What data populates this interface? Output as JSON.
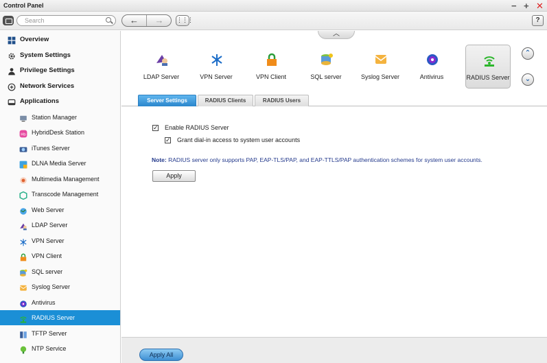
{
  "window": {
    "title": "Control Panel",
    "minimize": "−",
    "maximize": "+",
    "close": "✕"
  },
  "toolbar": {
    "search_placeholder": "Search",
    "back": "←",
    "forward": "→",
    "grid": "⋮⋮⋮",
    "help": "?"
  },
  "sidebar": {
    "items": [
      {
        "label": "Overview",
        "type": "cat",
        "icon": "overview-icon"
      },
      {
        "label": "System Settings",
        "type": "cat",
        "icon": "gear-icon"
      },
      {
        "label": "Privilege Settings",
        "type": "cat",
        "icon": "user-icon"
      },
      {
        "label": "Network Services",
        "type": "cat",
        "icon": "network-icon"
      },
      {
        "label": "Applications",
        "type": "cat",
        "icon": "applications-icon"
      },
      {
        "label": "Station Manager",
        "type": "sub",
        "icon": "station-manager-icon"
      },
      {
        "label": "HybridDesk Station",
        "type": "sub",
        "icon": "hybriddesk-icon"
      },
      {
        "label": "iTunes Server",
        "type": "sub",
        "icon": "itunes-icon"
      },
      {
        "label": "DLNA Media Server",
        "type": "sub",
        "icon": "dlna-icon"
      },
      {
        "label": "Multimedia Management",
        "type": "sub",
        "icon": "multimedia-icon"
      },
      {
        "label": "Transcode Management",
        "type": "sub",
        "icon": "transcode-icon"
      },
      {
        "label": "Web Server",
        "type": "sub",
        "icon": "web-server-icon"
      },
      {
        "label": "LDAP Server",
        "type": "sub",
        "icon": "ldap-icon"
      },
      {
        "label": "VPN Server",
        "type": "sub",
        "icon": "vpn-server-icon"
      },
      {
        "label": "VPN Client",
        "type": "sub",
        "icon": "vpn-client-icon"
      },
      {
        "label": "SQL server",
        "type": "sub",
        "icon": "sql-icon"
      },
      {
        "label": "Syslog Server",
        "type": "sub",
        "icon": "syslog-icon"
      },
      {
        "label": "Antivirus",
        "type": "sub",
        "icon": "antivirus-icon"
      },
      {
        "label": "RADIUS Server",
        "type": "sub",
        "icon": "radius-icon",
        "active": true
      },
      {
        "label": "TFTP Server",
        "type": "sub",
        "icon": "tftp-icon"
      },
      {
        "label": "NTP Service",
        "type": "sub",
        "icon": "ntp-icon"
      }
    ]
  },
  "apps": [
    {
      "label": "LDAP Server",
      "icon": "ldap-icon"
    },
    {
      "label": "VPN Server",
      "icon": "vpn-server-icon"
    },
    {
      "label": "VPN Client",
      "icon": "vpn-client-icon"
    },
    {
      "label": "SQL server",
      "icon": "sql-icon"
    },
    {
      "label": "Syslog Server",
      "icon": "syslog-icon"
    },
    {
      "label": "Antivirus",
      "icon": "antivirus-icon"
    },
    {
      "label": "RADIUS Server",
      "icon": "radius-icon",
      "selected": true
    }
  ],
  "tabs": [
    {
      "label": "Server Settings",
      "active": true
    },
    {
      "label": "RADIUS Clients"
    },
    {
      "label": "RADIUS Users"
    }
  ],
  "form": {
    "enable_label": "Enable RADIUS Server",
    "enable_checked": true,
    "grant_label": "Grant dial-in access to system user accounts",
    "grant_checked": true,
    "note_prefix": "Note:",
    "note_text": " RADIUS server only supports PAP, EAP-TLS/PAP, and EAP-TTLS/PAP authentication schemes for system user accounts.",
    "apply_label": "Apply",
    "checkmark": "✓"
  },
  "footer": {
    "apply_all_label": "Apply All"
  },
  "colors": {
    "accent": "#1b8fd6",
    "note": "#243a8c",
    "close": "#dd2222"
  }
}
